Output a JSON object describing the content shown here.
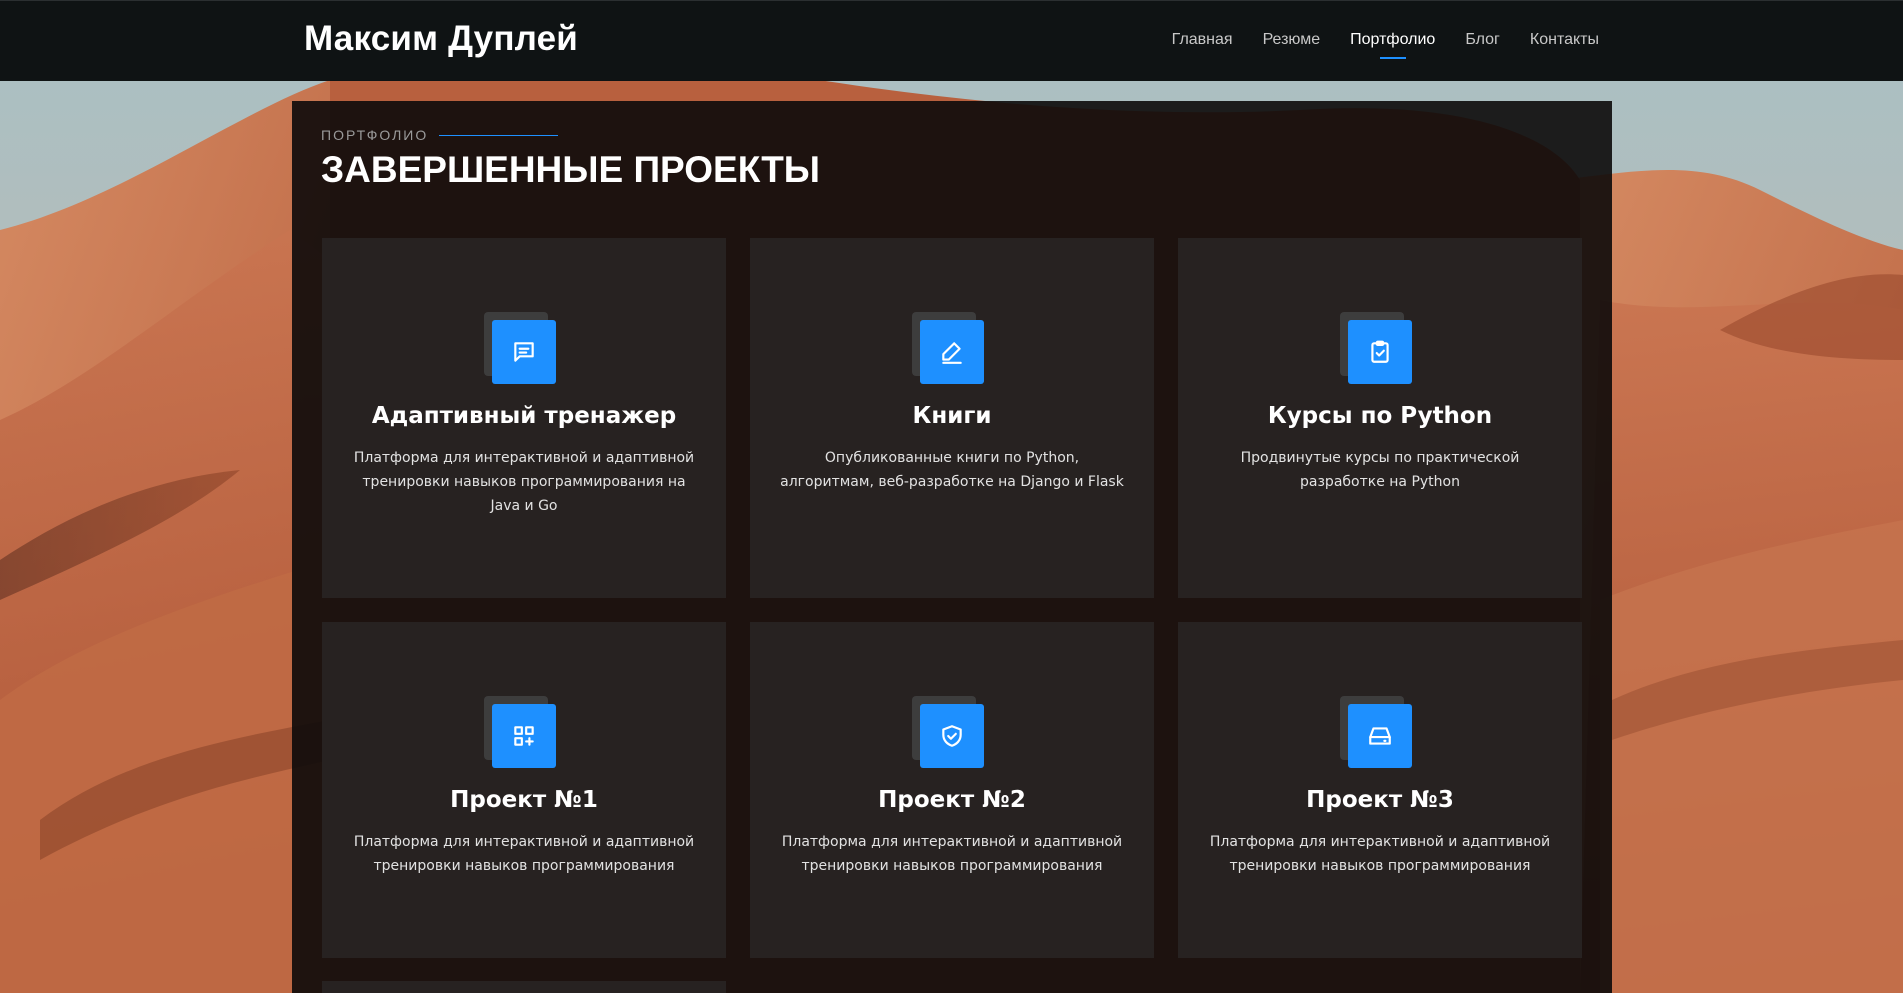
{
  "header": {
    "brand": "Максим Дуплей",
    "nav": [
      {
        "label": "Главная",
        "active": false
      },
      {
        "label": "Резюме",
        "active": false
      },
      {
        "label": "Портфолио",
        "active": true
      },
      {
        "label": "Блог",
        "active": false
      },
      {
        "label": "Контакты",
        "active": false
      }
    ]
  },
  "section": {
    "kicker": "ПОРТФОЛИО",
    "title": "ЗАВЕРШЕННЫЕ ПРОЕКТЫ"
  },
  "cards": [
    {
      "icon": "chat-icon",
      "title": "Адаптивный тренажер",
      "description": "Платформа для интерактивной и адаптивной тренировки навыков программирования на Java и Go"
    },
    {
      "icon": "pen-icon",
      "title": "Книги",
      "description": "Опубликованные книги по Python, алгоритмам, веб-разработке на Django и Flask"
    },
    {
      "icon": "clipboard-check-icon",
      "title": "Курсы по Python",
      "description": "Продвинутые курсы по практической разработке на Python"
    },
    {
      "icon": "qr-grid-icon",
      "title": "Проект №1",
      "description": "Платформа для интерактивной и адаптивной тренировки навыков программирования"
    },
    {
      "icon": "shield-check-icon",
      "title": "Проект №2",
      "description": "Платформа для интерактивной и адаптивной тренировки навыков программирования"
    },
    {
      "icon": "hard-drive-icon",
      "title": "Проект №3",
      "description": "Платформа для интерактивной и адаптивной тренировки навыков программирования"
    }
  ],
  "colors": {
    "accent": "#1e90ff",
    "header_bg": "#0f1314",
    "panel_bg": "#0c0a0a",
    "card_bg": "#282423"
  }
}
